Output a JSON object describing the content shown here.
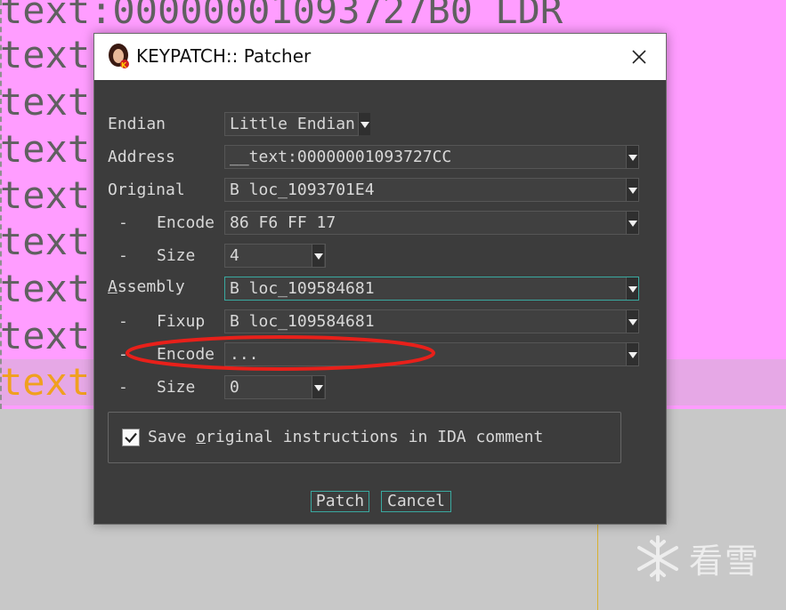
{
  "background": {
    "lines": [
      "text:00000001093727B0 LDR",
      "text",
      "text",
      "text",
      "text",
      "text",
      "text",
      "text",
      "text"
    ],
    "watermark_text": "看雪"
  },
  "dialog": {
    "title": "KEYPATCH:: Patcher",
    "rows": {
      "endian": {
        "label": "Endian",
        "value": "Little Endian"
      },
      "address": {
        "label": "Address",
        "value": "__text:00000001093727CC"
      },
      "original": {
        "label": "Original",
        "value": "B loc_1093701E4"
      },
      "original_encode": {
        "dash": "-",
        "label": "Encode",
        "value": "86 F6 FF 17"
      },
      "original_size": {
        "dash": "-",
        "label": "Size",
        "value": "4"
      },
      "assembly": {
        "label_first": "A",
        "label_rest": "ssembly",
        "value": "B loc_109584681"
      },
      "fixup": {
        "dash": "-",
        "label": "Fixup",
        "value": "B loc_109584681"
      },
      "assembly_encode": {
        "dash": "-",
        "label": "Encode",
        "value": "..."
      },
      "assembly_size": {
        "dash": "-",
        "label": "Size",
        "value": "0"
      }
    },
    "checkbox": {
      "checked": true,
      "label_before": "Save ",
      "label_u": "o",
      "label_after": "riginal instructions in IDA comment"
    },
    "buttons": {
      "patch": "Patch",
      "cancel": "Cancel"
    }
  },
  "colors": {
    "dialog_bg": "#3c3c3c",
    "accent": "#3aa9a0",
    "annotation": "#e8201a",
    "ida_bg": "#ff9dff"
  }
}
